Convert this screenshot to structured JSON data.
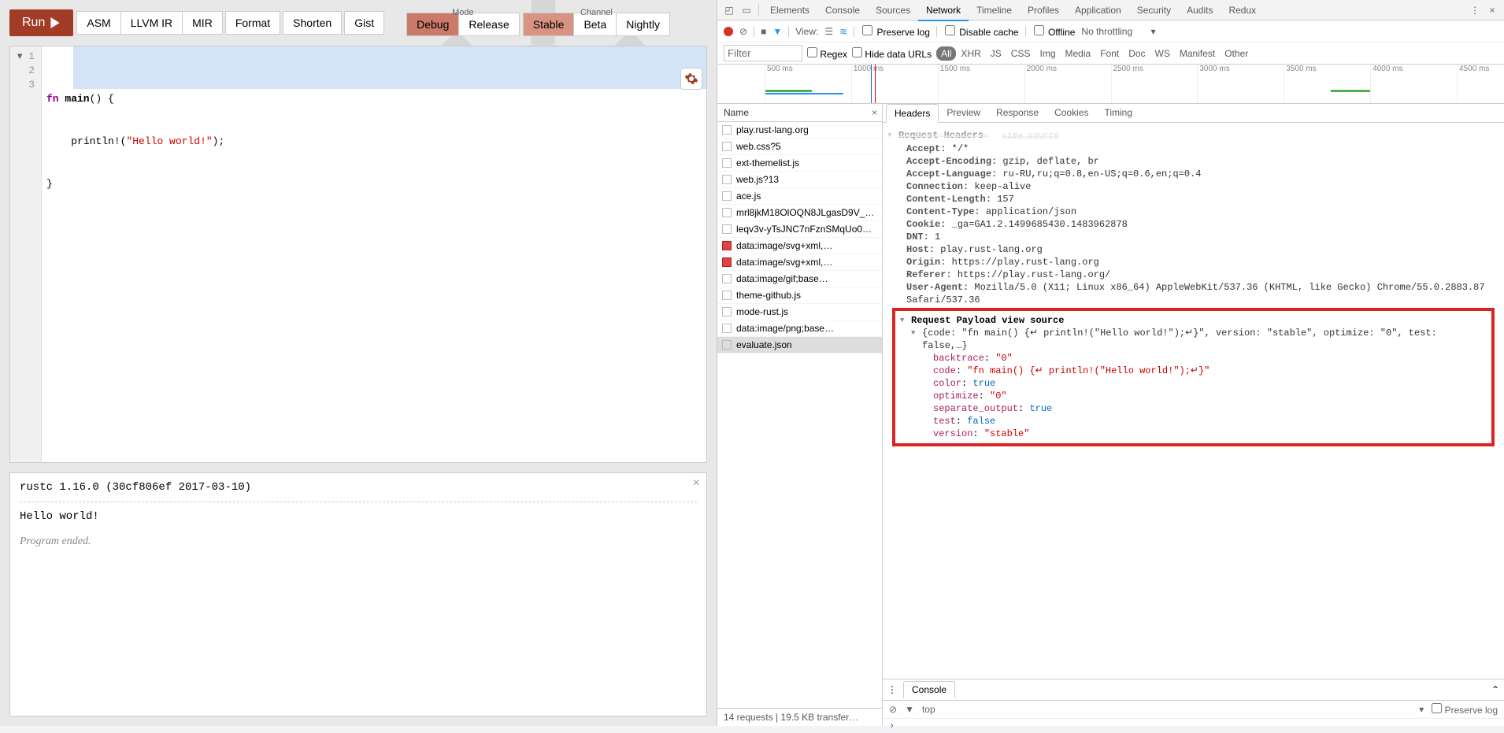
{
  "playground": {
    "run_label": "Run",
    "buttons": {
      "asm": "ASM",
      "llvm": "LLVM IR",
      "mir": "MIR",
      "format": "Format",
      "shorten": "Shorten",
      "gist": "Gist"
    },
    "mode_label": "Mode",
    "mode": {
      "debug": "Debug",
      "release": "Release"
    },
    "channel_label": "Channel",
    "channel": {
      "stable": "Stable",
      "beta": "Beta",
      "nightly": "Nightly"
    },
    "code": {
      "line1_kw": "fn ",
      "line1_name": "main",
      "line1_rest": "() {",
      "line2_indent": "    ",
      "line2_macro": "println!",
      "line2_p": "(",
      "line2_str": "\"Hello world!\"",
      "line2_end": ");",
      "line3": "}",
      "gutter": [
        "1",
        "2",
        "3"
      ]
    },
    "output": {
      "compiler": "rustc 1.16.0 (30cf806ef 2017-03-10)",
      "text": "Hello world!",
      "ended": "Program ended."
    }
  },
  "devtools": {
    "tabs": [
      "Elements",
      "Console",
      "Sources",
      "Network",
      "Timeline",
      "Profiles",
      "Application",
      "Security",
      "Audits",
      "Redux"
    ],
    "active_tab": "Network",
    "view_label": "View:",
    "preserve_log": "Preserve log",
    "disable_cache": "Disable cache",
    "offline": "Offline",
    "throttling": "No throttling",
    "filter_placeholder": "Filter",
    "regex": "Regex",
    "hide_data": "Hide data URLs",
    "filter_pills": [
      "All",
      "XHR",
      "JS",
      "CSS",
      "Img",
      "Media",
      "Font",
      "Doc",
      "WS",
      "Manifest",
      "Other"
    ],
    "timeline_ticks": [
      {
        "label": "500 ms",
        "pct": 6
      },
      {
        "label": "1000 ms",
        "pct": 17
      },
      {
        "label": "1500 ms",
        "pct": 28
      },
      {
        "label": "2000 ms",
        "pct": 39
      },
      {
        "label": "2500 ms",
        "pct": 50
      },
      {
        "label": "3000 ms",
        "pct": 61
      },
      {
        "label": "3500 ms",
        "pct": 72
      },
      {
        "label": "4000 ms",
        "pct": 83
      },
      {
        "label": "4500 ms",
        "pct": 94
      }
    ],
    "name_header": "Name",
    "requests": [
      {
        "name": "play.rust-lang.org",
        "icon": "doc"
      },
      {
        "name": "web.css?5",
        "icon": "doc"
      },
      {
        "name": "ext-themelist.js",
        "icon": "doc"
      },
      {
        "name": "web.js?13",
        "icon": "doc"
      },
      {
        "name": "ace.js",
        "icon": "doc"
      },
      {
        "name": "mrl8jkM18OlOQN8JLgasD9V_…",
        "icon": "doc"
      },
      {
        "name": "leqv3v-yTsJNC7nFznSMqUo0…",
        "icon": "doc"
      },
      {
        "name": "data:image/svg+xml,…",
        "icon": "img"
      },
      {
        "name": "data:image/svg+xml,…",
        "icon": "img"
      },
      {
        "name": "data:image/gif;base…",
        "icon": "doc"
      },
      {
        "name": "theme-github.js",
        "icon": "doc"
      },
      {
        "name": "mode-rust.js",
        "icon": "doc"
      },
      {
        "name": "data:image/png;base…",
        "icon": "doc"
      },
      {
        "name": "evaluate.json",
        "icon": "doc",
        "selected": true
      }
    ],
    "status_bar": "14 requests   |   19.5 KB transfer…",
    "detail_tabs": [
      "Headers",
      "Preview",
      "Response",
      "Cookies",
      "Timing"
    ],
    "headers": {
      "section_title": "Request Headers",
      "view_source": "view source",
      "items": [
        {
          "k": "Accept:",
          "v": "*/*"
        },
        {
          "k": "Accept-Encoding:",
          "v": "gzip, deflate, br"
        },
        {
          "k": "Accept-Language:",
          "v": "ru-RU,ru;q=0.8,en-US;q=0.6,en;q=0.4"
        },
        {
          "k": "Connection:",
          "v": "keep-alive"
        },
        {
          "k": "Content-Length:",
          "v": "157"
        },
        {
          "k": "Content-Type:",
          "v": "application/json"
        },
        {
          "k": "Cookie:",
          "v": "_ga=GA1.2.1499685430.1483962878"
        },
        {
          "k": "DNT:",
          "v": "1"
        },
        {
          "k": "Host:",
          "v": "play.rust-lang.org"
        },
        {
          "k": "Origin:",
          "v": "https://play.rust-lang.org"
        },
        {
          "k": "Referer:",
          "v": "https://play.rust-lang.org/"
        },
        {
          "k": "User-Agent:",
          "v": "Mozilla/5.0 (X11; Linux x86_64) AppleWebKit/537.36 (KHTML, like Gecko) Chrome/55.0.2883.87 Safari/537.36"
        }
      ]
    },
    "payload": {
      "title": "Request Payload",
      "view_source": "view source",
      "summary": "{code: \"fn main() {↵ println!(\"Hello world!\");↵}\", version: \"stable\", optimize: \"0\", test: false,…}",
      "kv": [
        {
          "k": "backtrace",
          "v": "\"0\"",
          "t": "str"
        },
        {
          "k": "code",
          "v": "\"fn main() {↵    println!(\"Hello world!\");↵}\"",
          "t": "str"
        },
        {
          "k": "color",
          "v": "true",
          "t": "lit"
        },
        {
          "k": "optimize",
          "v": "\"0\"",
          "t": "str"
        },
        {
          "k": "separate_output",
          "v": "true",
          "t": "lit"
        },
        {
          "k": "test",
          "v": "false",
          "t": "lit"
        },
        {
          "k": "version",
          "v": "\"stable\"",
          "t": "str"
        }
      ]
    },
    "console": {
      "tab": "Console",
      "top": "top",
      "preserve": "Preserve log"
    }
  }
}
